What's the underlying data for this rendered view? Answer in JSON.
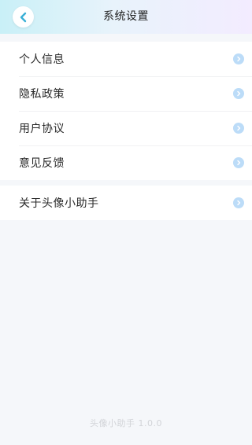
{
  "header": {
    "title": "系统设置",
    "back_icon": "chevron-left-icon",
    "accent_color": "#3ab0d6"
  },
  "settings": {
    "items": [
      {
        "label": "个人信息",
        "icon": "chevron-right-icon"
      },
      {
        "label": "隐私政策",
        "icon": "chevron-right-icon"
      },
      {
        "label": "用户协议",
        "icon": "chevron-right-icon"
      },
      {
        "label": "意见反馈",
        "icon": "chevron-right-icon"
      }
    ],
    "about": {
      "label": "关于头像小助手",
      "icon": "chevron-right-icon"
    }
  },
  "footer": {
    "version": "头像小助手 1.0.0"
  }
}
